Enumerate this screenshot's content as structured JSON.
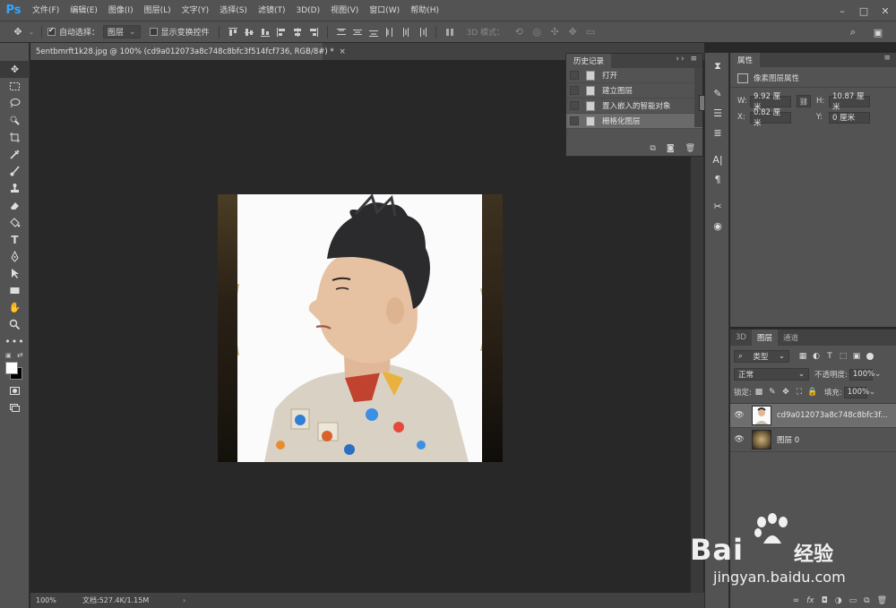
{
  "app": {
    "logo": "Ps"
  },
  "menu": [
    "文件(F)",
    "编辑(E)",
    "图像(I)",
    "图层(L)",
    "文字(Y)",
    "选择(S)",
    "滤镜(T)",
    "3D(D)",
    "视图(V)",
    "窗口(W)",
    "帮助(H)"
  ],
  "window_controls": {
    "minimize": "–",
    "maximize": "□",
    "close": "✕"
  },
  "options": {
    "auto_select_label": "自动选择：",
    "auto_select_checked": true,
    "auto_select_value": "图层",
    "show_transform_label": "显示变换控件",
    "show_transform_checked": false,
    "mode3d_label": "3D 模式："
  },
  "document": {
    "tab_title": "5entbmrft1k28.jpg @ 100% (cd9a012073a8c748c8bfc3f514fcf736, RGB/8#) *",
    "close": "×",
    "zoom": "100%",
    "doc_info": "文档:527.4K/1.15M",
    "status_arrow": "›"
  },
  "history": {
    "title": "历史记录",
    "controls": "›› ≡",
    "items": [
      {
        "label": "打开",
        "active": false
      },
      {
        "label": "建立图层",
        "active": false
      },
      {
        "label": "置入嵌入的智能对象",
        "active": false
      },
      {
        "label": "栅格化图层",
        "active": true
      }
    ]
  },
  "properties": {
    "title": "属性",
    "section": "像素图层属性",
    "w_label": "W:",
    "w_value": "9.92 厘米",
    "h_label": "H:",
    "h_value": "10.87 厘米",
    "x_label": "X:",
    "x_value": "0.82 厘米",
    "y_label": "Y:",
    "y_value": "0 厘米"
  },
  "layers_panel": {
    "tabs": [
      "3D",
      "图层",
      "通道"
    ],
    "active_tab": "图层",
    "filter_kind": "类型",
    "blend_mode": "正常",
    "opacity_label": "不透明度:",
    "opacity_value": "100%",
    "lock_label": "锁定:",
    "fill_label": "填充:",
    "fill_value": "100%",
    "layers": [
      {
        "name": "cd9a012073a8c748c8bfc3f...",
        "selected": true,
        "thumb": "portrait"
      },
      {
        "name": "图层 0",
        "selected": false,
        "thumb": "texture"
      }
    ]
  },
  "watermark": {
    "brand": "Bai",
    "brand_cn": "经验",
    "url": "jingyan.baidu.com"
  },
  "colors": {
    "accent_ps": "#31a8ff",
    "panel_bg": "#535353",
    "canvas_bg": "#282828"
  }
}
